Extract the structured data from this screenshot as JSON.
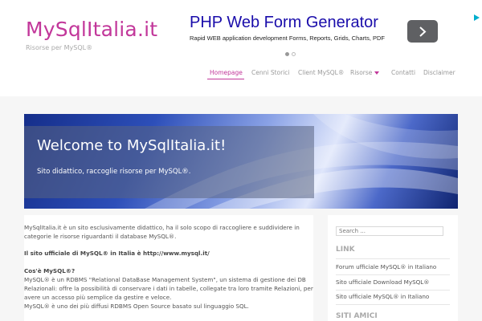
{
  "site": {
    "title": "MySqlItalia.it",
    "description": "Risorse per MySQL®"
  },
  "ad": {
    "title": "PHP Web Form Generator",
    "text": "Rapid WEB application development Forms, Reports, Grids, Charts, PDF",
    "next_icon": "chevron-right-icon",
    "corner_icon": "adchoices-icon"
  },
  "nav": {
    "items": [
      {
        "label": "Homepage"
      },
      {
        "label": "Cenni Storici"
      },
      {
        "label": "Client MySQL®"
      },
      {
        "label": "Risorse"
      },
      {
        "label": "Contatti"
      },
      {
        "label": "Disclaimer"
      }
    ],
    "dropdown_icon": "caret-down-icon"
  },
  "hero": {
    "title": "Welcome to MySqlItalia.it!",
    "subtitle": "Sito didattico, raccoglie risorse per MySQL®."
  },
  "content": {
    "intro_line1": "MySqlItalia.it è un sito esclusivamente didattico, ha il solo scopo di raccogliere e suddividere in",
    "intro_line2": "categorie le risorse riguardanti il database MySQL®.",
    "official": "Il sito ufficiale di MySQL® in Italia è http://www.mysql.it/",
    "what_heading": "Cos'è MySQL®?",
    "what_line1": "MySQL® è un RDBMS \"Relational DataBase Management System\", un sistema di gestione dei DB",
    "what_line2": "Relazionali: offre la possibilità di conservare i dati in tabelle, collegate tra loro tramite Relazioni, per",
    "what_line3": "avere un accesso più semplice da gestire e veloce.",
    "what_line4": "MySQL® è uno dei più diffusi RDBMS Open Source basato sul linguaggio SQL."
  },
  "sidebar": {
    "search_placeholder": "Search ...",
    "link_title": "LINK",
    "links": [
      {
        "label": "Forum ufficiale MySQL® in Italiano"
      },
      {
        "label": "Sito ufficiale Download MySQL®"
      },
      {
        "label": "Sito ufficiale MySQL® in Italiano"
      }
    ],
    "friends_title": "SITI AMICI"
  },
  "colors": {
    "accent": "#c2379a",
    "ad_link": "#1a0dab"
  }
}
